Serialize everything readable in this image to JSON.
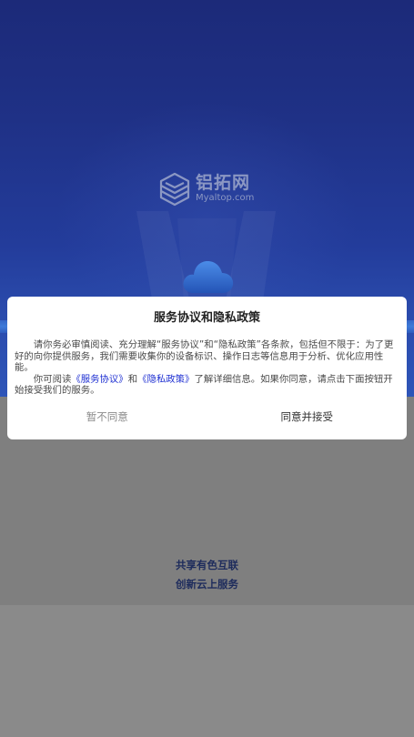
{
  "splash": {
    "logo_name": "铝拓网",
    "logo_url": "Myaltop.com",
    "slogan_line1": "共享有色互联",
    "slogan_line2": "创新云上服务"
  },
  "dialog": {
    "title": "服务协议和隐私政策",
    "paragraph1": "请你务必审慎阅读、充分理解“服务协议”和“隐私政策”各条款，包括但不限于：为了更好的向你提供服务，我们需要收集你的设备标识、操作日志等信息用于分析、优化应用性能。",
    "paragraph2": {
      "prefix": "你可阅读",
      "link_service": "《服务协议》",
      "middle": "和",
      "link_privacy": "《隐私政策》",
      "suffix": "了解详细信息。如果你同意，请点击下面按钮开始接受我们的服务。"
    },
    "decline_label": "暂不同意",
    "accept_label": "同意并接受"
  },
  "icons": {
    "logo": "altop-logo-icon",
    "cloud": "cloud-icon"
  },
  "colors": {
    "link": "#1f30d2",
    "decline": "#8a8a8a",
    "accept": "#333333",
    "slogan": "#1d2b5c",
    "title": "#222222",
    "logo": "#8b97c3",
    "splash_blue": "#233c9b"
  }
}
